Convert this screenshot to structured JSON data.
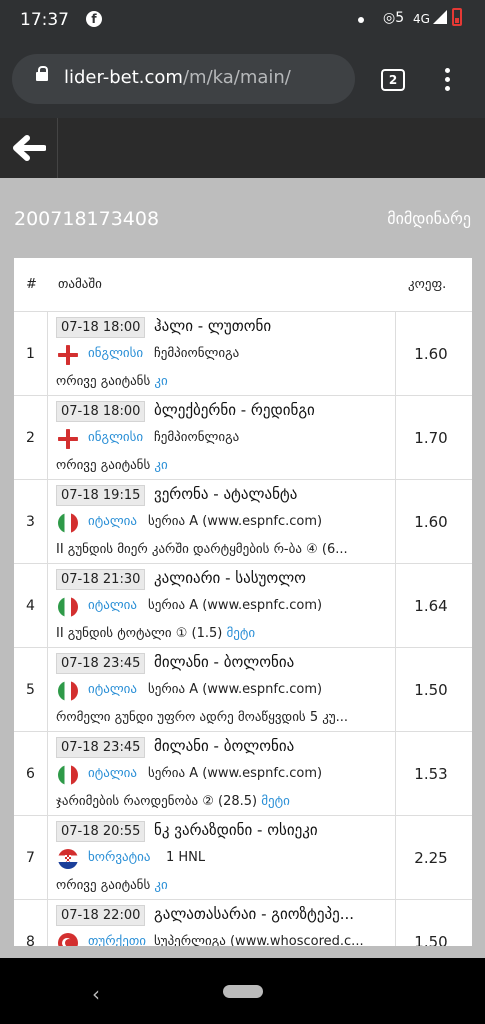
{
  "status": {
    "time": "17:37",
    "net": "4G",
    "hotspot": "◎5"
  },
  "browser": {
    "domain": "lider-bet.com",
    "path": "/m/ka/main/",
    "tab_count": "2"
  },
  "ticket": {
    "id": "200718173408",
    "status": "მიმდინარე"
  },
  "table": {
    "headers": {
      "num": "#",
      "game": "თამაში",
      "odds": "კოეფ."
    },
    "rows": [
      {
        "num": "1",
        "date": "07-18 18:00",
        "match": "ჰალი - ლუთონი",
        "flag": "england",
        "country": "ინგლისი",
        "league": "ჩემპიონლიგა",
        "bet": "ორივე გაიტანს",
        "bet_link": "კი",
        "odds": "1.60"
      },
      {
        "num": "2",
        "date": "07-18 18:00",
        "match": "ბლექბერნი - რედინგი",
        "flag": "england",
        "country": "ინგლისი",
        "league": "ჩემპიონლიგა",
        "bet": "ორივე გაიტანს",
        "bet_link": "კი",
        "odds": "1.70"
      },
      {
        "num": "3",
        "date": "07-18 19:15",
        "match": "ვერონა - ატალანტა",
        "flag": "italy",
        "country": "იტალია",
        "league": "სერია A (www.espnfc.com)",
        "bet": "II გუნდის მიერ კარში დარტყმების რ-ბა ④ (6...",
        "bet_link": "",
        "odds": "1.60"
      },
      {
        "num": "4",
        "date": "07-18 21:30",
        "match": "კალიარი - სასუოლო",
        "flag": "italy",
        "country": "იტალია",
        "league": "სერია A (www.espnfc.com)",
        "bet": "II გუნდის ტოტალი ① (1.5) ",
        "bet_link": "მეტი",
        "odds": "1.64"
      },
      {
        "num": "5",
        "date": "07-18 23:45",
        "match": "მილანი - ბოლონია",
        "flag": "italy",
        "country": "იტალია",
        "league": "სერია A (www.espnfc.com)",
        "bet": "რომელი გუნდი უფრო ადრე მოაწყვდის 5 კუ...",
        "bet_link": "",
        "odds": "1.50"
      },
      {
        "num": "6",
        "date": "07-18 23:45",
        "match": "მილანი - ბოლონია",
        "flag": "italy",
        "country": "იტალია",
        "league": "სერია A (www.espnfc.com)",
        "bet": "ჯარიმების რაოდენობა ② (28.5) ",
        "bet_link": "მეტი",
        "odds": "1.53"
      },
      {
        "num": "7",
        "date": "07-18 20:55",
        "match": "ნკ ვარაზდინი - ოსიეკი",
        "flag": "croatia",
        "country": "ხორვატია",
        "league": "1 HNL",
        "bet": "ორივე გაიტანს",
        "bet_link": "კი",
        "odds": "2.25"
      },
      {
        "num": "8",
        "date": "07-18 22:00",
        "match": "გალათასარაი - გიოზტეპე...",
        "flag": "turkey",
        "country": "თურქეთი",
        "league": "სუპერლიგა (www.whoscored.c...",
        "bet": "",
        "bet_link": "",
        "odds": "1.50"
      }
    ]
  }
}
